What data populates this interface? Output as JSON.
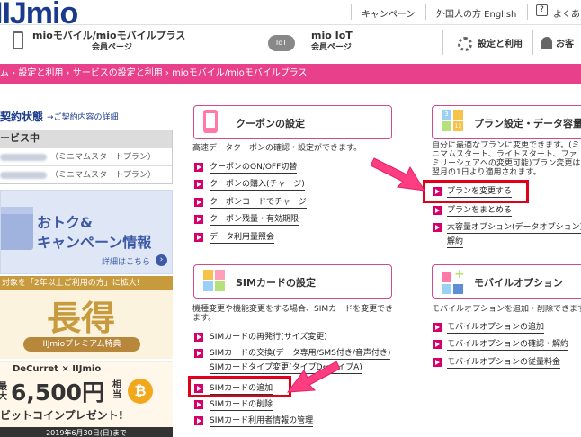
{
  "header": {
    "logo": "IIJmio",
    "top_links": [
      "キャンペーン",
      "外国人の方 English",
      "よくあ"
    ],
    "nav": [
      {
        "title": "mioモバイル/mioモバイルプラス",
        "sub": "会員ページ"
      },
      {
        "title": "mio IoT",
        "sub": "会員ページ"
      },
      {
        "title": "設定と利用"
      },
      {
        "title": "お客"
      }
    ]
  },
  "breadcrumb": "ム › 設定と利用 › サービスの設定と利用 › mioモバイル/mioモバイルプラス",
  "sidebar": {
    "title": "契約状態",
    "detail_link": "→ご契約内容の詳細",
    "status_head": "ービス中",
    "rows": [
      "（ミニマムスタートプラン）",
      "（ミニマムスタートプラン）"
    ],
    "banner1": {
      "line1": "おトク&",
      "line2": "キャンペーン情報",
      "more": "詳細はこちら"
    },
    "banner2": {
      "top": "対象を「2年以上ご利用の方」に拡大!",
      "big": "長得",
      "sub": "IIJmioプレミアム特典"
    },
    "banner3": {
      "brand": "DeCurret × IIJmio",
      "prefix": "最大",
      "amount": "6,500円",
      "suffix": "相当",
      "line2": "ビットコインプレゼント!",
      "date": "2019年6月30日(日)まで"
    }
  },
  "coupon": {
    "title": "クーポンの設定",
    "desc": "高速データクーポンの確認・設定ができます。",
    "links": [
      "クーポンのON/OFF切替",
      "クーポンの購入(チャージ)",
      "クーポンコードでチャージ",
      "クーポン残量・有効期限",
      "データ利用量照会"
    ]
  },
  "sim": {
    "title": "SIMカードの設定",
    "desc": "機種変更や機能変更をする場合、SIMカードを変更できます。",
    "links": [
      "SIMカードの再発行(サイズ変更)",
      "SIMカードの交換(データ専用/SMS付き/音声付き)",
      "SIMカードタイプ変更(タイプD⇔タイプA)",
      "SIMカードの追加",
      "SIMカードの削除",
      "SIMカード利用者情報の管理"
    ]
  },
  "plan": {
    "title": "プラン設定・データ容量",
    "desc": "自分に最適なプランに変更できます。(ミニマムスタート、ライトスタート、ファミリーシェアへの変更可能)プラン変更は翌月の1日より適用されます。",
    "links": [
      "プランを変更する",
      "プランをまとめる",
      "大容量オプション(データオプション)",
      "解約"
    ]
  },
  "option": {
    "title": "モバイルオプション",
    "desc": "モバイルオプションを追加・削除できます。",
    "links": [
      "モバイルオプションの追加",
      "モバイルオプションの確認・解約",
      "モバイルオプションの従量料金"
    ]
  },
  "colors": {
    "accent": "#e8408a",
    "highlight": "#e0001a",
    "brand": "#1a3a8c"
  }
}
